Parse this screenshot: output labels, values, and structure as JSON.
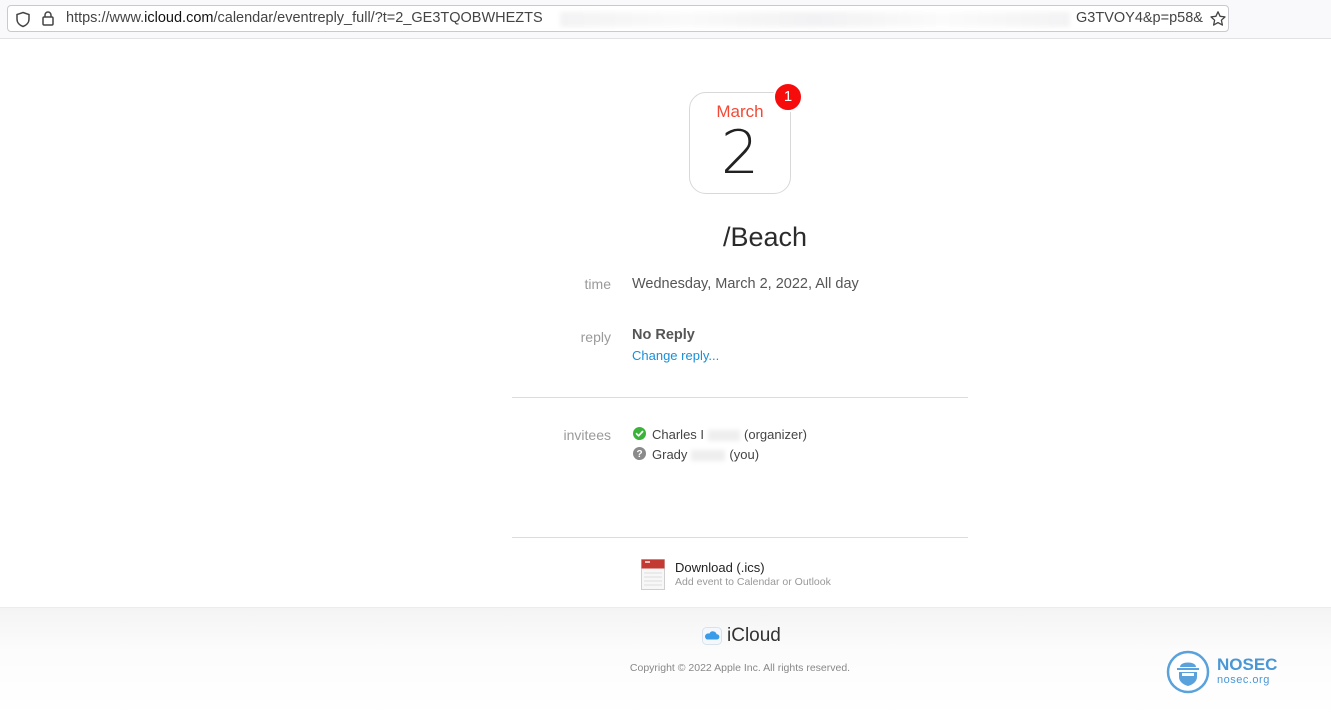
{
  "browser": {
    "url_visible_left": "https://www.",
    "url_host": "icloud.com",
    "url_path": "/calendar/eventreply_full/?t=2_GE3TQOBWHEZTS",
    "url_visible_right": "G3TVOY4&p=p58&"
  },
  "calendar_icon": {
    "month": "March",
    "day": "2",
    "badge_count": "1"
  },
  "event": {
    "title": "/Beach",
    "time_label": "time",
    "time_value": "Wednesday, March 2, 2022, All day",
    "reply_label": "reply",
    "reply_value": "No Reply",
    "change_reply": "Change reply...",
    "invitees_label": "invitees",
    "invitees": [
      {
        "first_name": "Charles",
        "initial": "I",
        "role": "(organizer)",
        "status": "accepted"
      },
      {
        "first_name": "Grady",
        "initial": "",
        "role": "(you)",
        "status": "unknown"
      }
    ]
  },
  "download": {
    "title": "Download (.ics)",
    "subtitle": "Add event to Calendar or Outlook"
  },
  "footer": {
    "brand": "iCloud",
    "copyright": "Copyright © 2022 Apple Inc. All rights reserved."
  },
  "watermark": {
    "name": "NOSEC",
    "url": "nosec.org"
  },
  "colors": {
    "accent_link": "#1a8fd8",
    "month_red": "#f24a36",
    "badge_red": "#f70c0c",
    "accepted_green": "#3bb33b",
    "unknown_gray": "#8a8a8a"
  }
}
